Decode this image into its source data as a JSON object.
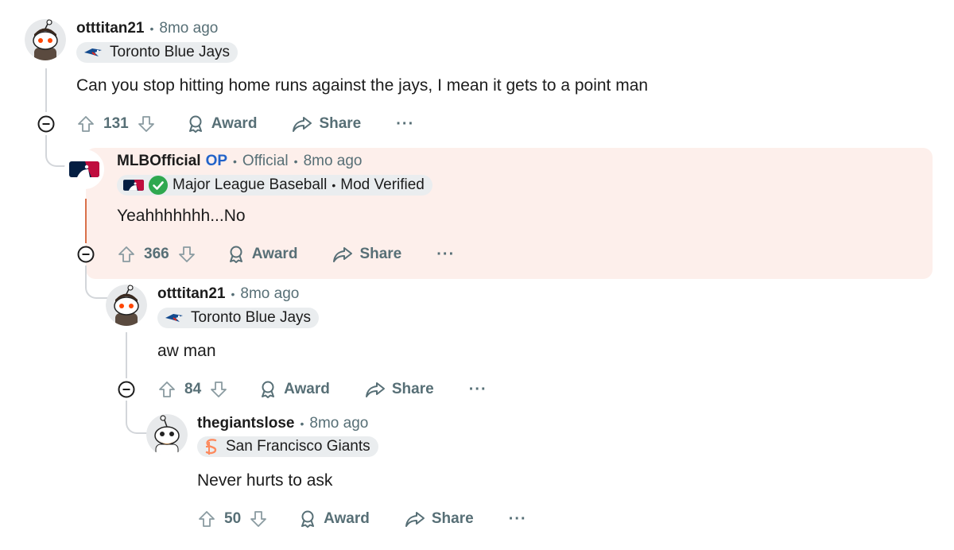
{
  "comments": [
    {
      "username": "otttitan21",
      "time": "8mo ago",
      "flair": "Toronto Blue Jays",
      "text": "Can you stop hitting home runs against the jays, I mean it gets to a point man",
      "votes": "131"
    },
    {
      "username": "MLBOfficial",
      "op": "OP",
      "role": "Official",
      "time": "8mo ago",
      "flair": "Major League Baseball",
      "flair_extra": "Mod Verified",
      "text": "Yeahhhhhhh...No",
      "votes": "366"
    },
    {
      "username": "otttitan21",
      "time": "8mo ago",
      "flair": "Toronto Blue Jays",
      "text": "aw man",
      "votes": "84"
    },
    {
      "username": "thegiantslose",
      "time": "8mo ago",
      "flair": "San Francisco Giants",
      "text": "Never hurts to ask",
      "votes": "50"
    }
  ],
  "actions": {
    "award": "Award",
    "share": "Share",
    "more": "···"
  },
  "separator": "•",
  "colors": {
    "op_blue": "#2263c9",
    "highlight_bg": "#fdefeb",
    "muted": "#576f76",
    "flair_bg": "#eaedef",
    "thread_highlight": "#d9704a"
  },
  "icons": [
    "upvote-icon",
    "downvote-icon",
    "award-icon",
    "share-icon",
    "collapse-icon",
    "blue-jays-icon",
    "mlb-logo-icon",
    "verified-check-icon",
    "sf-giants-icon"
  ]
}
